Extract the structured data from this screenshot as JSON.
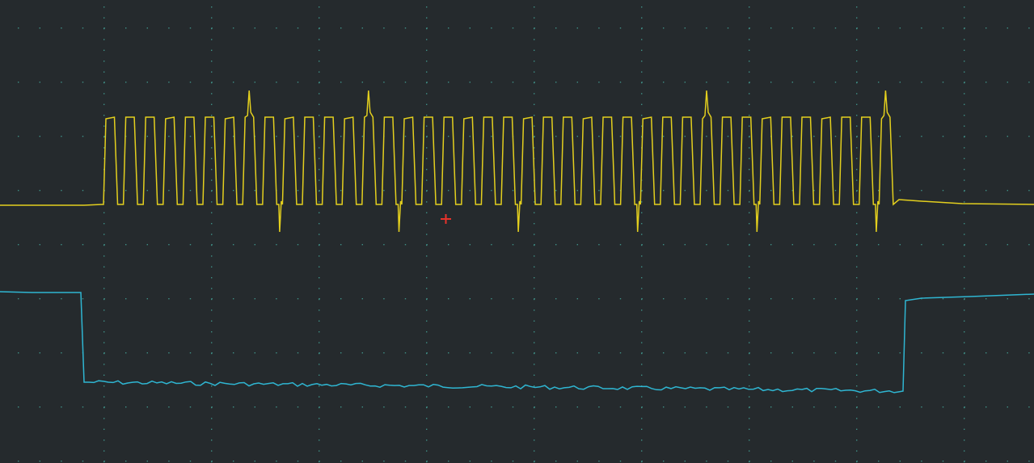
{
  "scope": {
    "background_color": "#252a2d",
    "grid_color": "#3f8f86",
    "trigger_marker_color": "#e8332b",
    "marker_icon": "trigger-crosshair-icon"
  },
  "channels": [
    {
      "id": "ch1",
      "color": "#e3cf1e",
      "description_visible": false
    },
    {
      "id": "ch2",
      "color": "#2fb6d2",
      "description_visible": false
    }
  ]
}
